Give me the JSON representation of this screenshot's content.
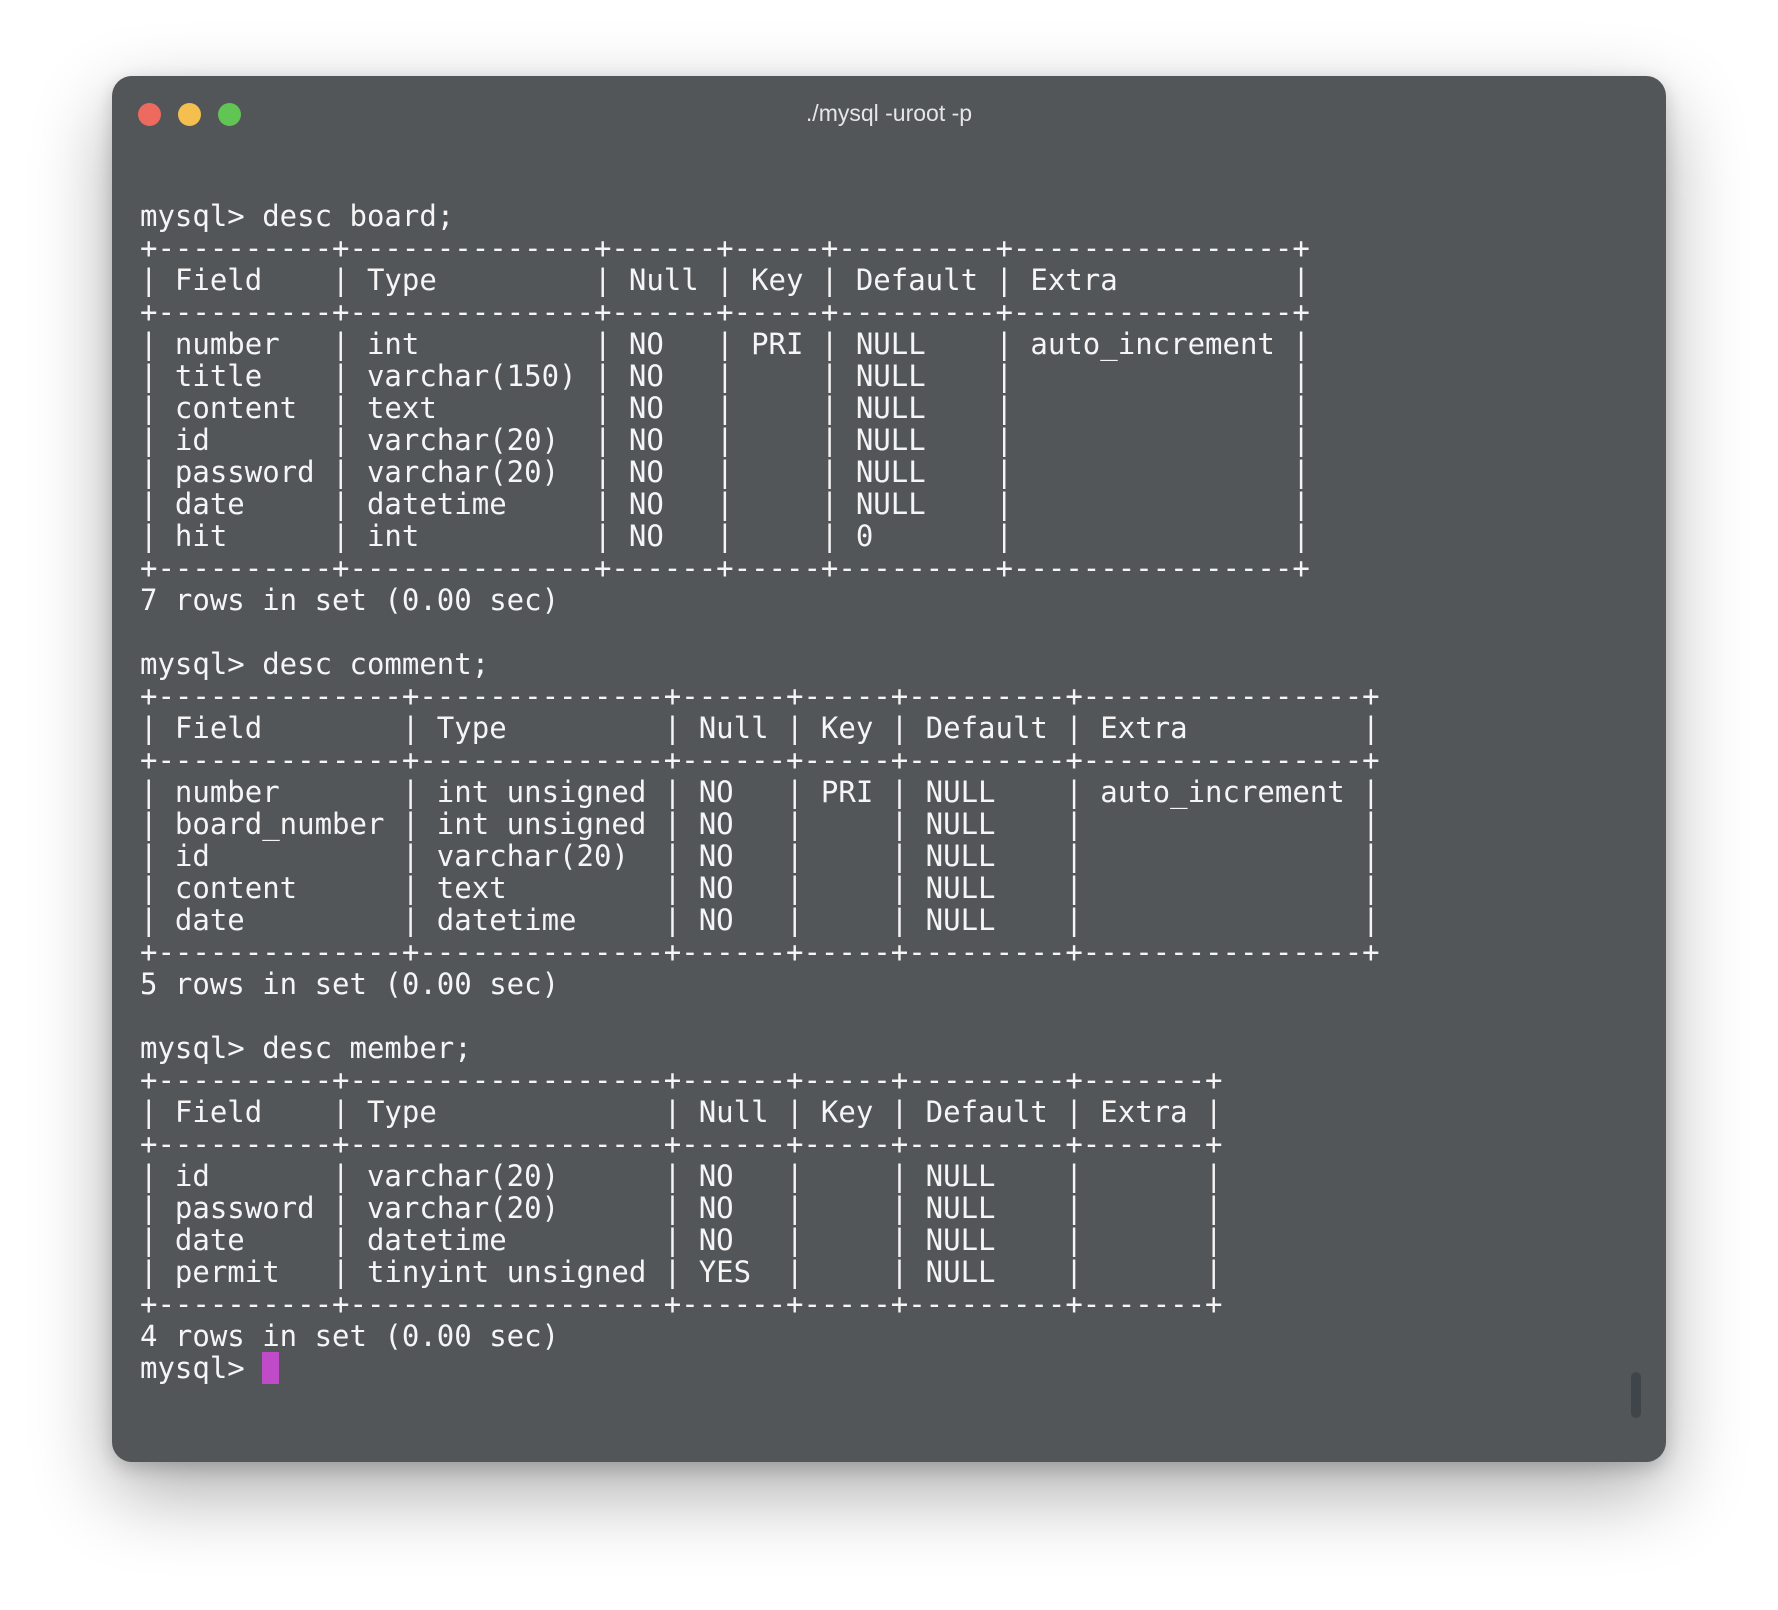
{
  "window": {
    "title": "./mysql -uroot -p",
    "traffic_lights": [
      "close",
      "minimize",
      "zoom"
    ],
    "colors": {
      "background": "#525659",
      "text": "#f5f5f5",
      "cursor": "#c04bc8",
      "close": "#ec6a5e",
      "minimize": "#f4bf4f",
      "zoom": "#61c554"
    }
  },
  "terminal": {
    "output": "mysql> desc board;\n+----------+--------------+------+-----+---------+----------------+\n| Field    | Type         | Null | Key | Default | Extra          |\n+----------+--------------+------+-----+---------+----------------+\n| number   | int          | NO   | PRI | NULL    | auto_increment |\n| title    | varchar(150) | NO   |     | NULL    |                |\n| content  | text         | NO   |     | NULL    |                |\n| id       | varchar(20)  | NO   |     | NULL    |                |\n| password | varchar(20)  | NO   |     | NULL    |                |\n| date     | datetime     | NO   |     | NULL    |                |\n| hit      | int          | NO   |     | 0       |                |\n+----------+--------------+------+-----+---------+----------------+\n7 rows in set (0.00 sec)\n\nmysql> desc comment;\n+--------------+--------------+------+-----+---------+----------------+\n| Field        | Type         | Null | Key | Default | Extra          |\n+--------------+--------------+------+-----+---------+----------------+\n| number       | int unsigned | NO   | PRI | NULL    | auto_increment |\n| board_number | int unsigned | NO   |     | NULL    |                |\n| id           | varchar(20)  | NO   |     | NULL    |                |\n| content      | text         | NO   |     | NULL    |                |\n| date         | datetime     | NO   |     | NULL    |                |\n+--------------+--------------+------+-----+---------+----------------+\n5 rows in set (0.00 sec)\n\nmysql> desc member;\n+----------+------------------+------+-----+---------+-------+\n| Field    | Type             | Null | Key | Default | Extra |\n+----------+------------------+------+-----+---------+-------+\n| id       | varchar(20)      | NO   |     | NULL    |       |\n| password | varchar(20)      | NO   |     | NULL    |       |\n| date     | datetime         | NO   |     | NULL    |       |\n| permit   | tinyint unsigned | YES  |     | NULL    |       |\n+----------+------------------+------+-----+---------+-------+\n4 rows in set (0.00 sec)\n",
    "prompt": "mysql> "
  }
}
